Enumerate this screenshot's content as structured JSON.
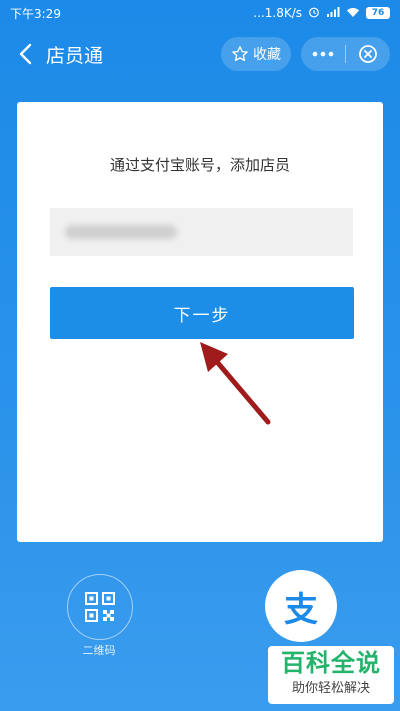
{
  "status": {
    "time": "下午3:29",
    "network_speed": "...1.8K/s",
    "battery": "76"
  },
  "header": {
    "title": "店员通",
    "favorite_label": "收藏"
  },
  "card": {
    "title": "通过支付宝账号，添加店员",
    "input_placeholder": "",
    "next_button_label": "下一步"
  },
  "bottom": {
    "qr_label": "二维码",
    "alipay_glyph": "支"
  },
  "watermark": {
    "main": "百科全说",
    "sub": "助你轻松解决"
  },
  "colors": {
    "primary": "#1c8ae8",
    "button": "#1d8ee8",
    "annotation_arrow": "#a01c1c",
    "watermark_green": "#23b36b"
  }
}
